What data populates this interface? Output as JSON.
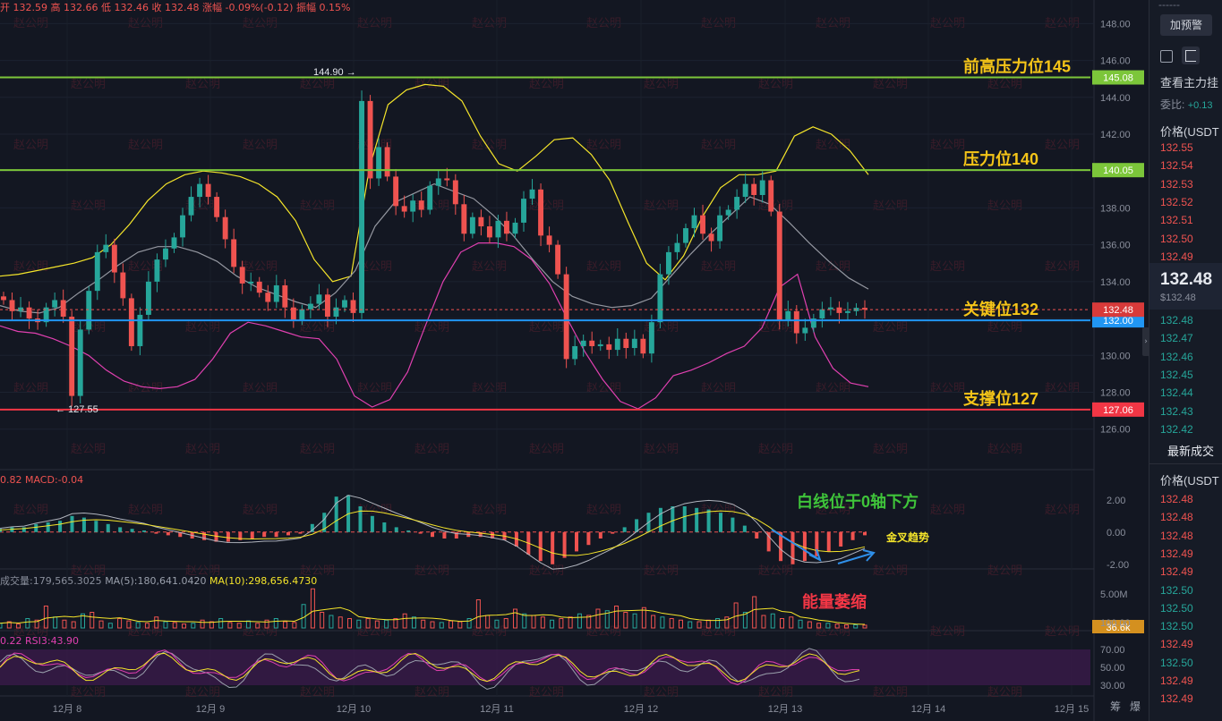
{
  "header": {
    "open": "开 132.59",
    "high": "高 132.66",
    "low": "低 132.46",
    "close": "收 132.48",
    "change": "涨幅 -0.09%(-0.12)",
    "amplitude": "振幅 0.15%"
  },
  "watermark": "赵公明",
  "colors": {
    "up": "#26a69a",
    "down": "#ef5350",
    "green_line": "#7cc63a",
    "red_line": "#f23645",
    "blue_line": "#2196f3",
    "label_text": "#f5c518",
    "boll_upper": "#f5e52a",
    "boll_lower": "#e040b0",
    "boll_mid": "#9598a1"
  },
  "chart_data": [
    {
      "type": "candlestick",
      "title": "",
      "ylim": [
        125.5,
        148.6
      ],
      "yticks": [
        "148.00",
        "146.00",
        "144.00",
        "142.00",
        "140.00",
        "138.00",
        "136.00",
        "134.00",
        "132.00",
        "130.00",
        "128.00",
        "126.00"
      ],
      "xticks": [
        "12月 8",
        "12月 9",
        "12月 10",
        "12月 11",
        "12月 12",
        "12月 13",
        "12月 14",
        "12月 15"
      ],
      "price_series": [
        133.0,
        132.4,
        132.6,
        132.0,
        131.8,
        132.6,
        133.0,
        132.1,
        127.8,
        131.4,
        133.5,
        135.6,
        136.0,
        134.5,
        133.1,
        130.5,
        132.2,
        134.0,
        135.2,
        135.8,
        136.4,
        137.6,
        138.6,
        139.3,
        138.6,
        137.5,
        136.3,
        134.8,
        133.9,
        134.0,
        133.4,
        132.9,
        133.8,
        132.6,
        131.9,
        132.5,
        132.8,
        133.3,
        132.1,
        132.6,
        133.0,
        132.3,
        143.8,
        139.6,
        141.3,
        139.7,
        138.1,
        137.8,
        138.4,
        137.9,
        139.2,
        139.6,
        139.5,
        138.2,
        136.6,
        137.5,
        137.0,
        136.4,
        137.3,
        136.6,
        137.2,
        138.5,
        139.0,
        136.5,
        136.0,
        134.4,
        129.8,
        130.5,
        130.8,
        130.5,
        130.6,
        130.3,
        130.9,
        130.4,
        130.9,
        130.1,
        131.8,
        134.4,
        135.6,
        136.1,
        136.9,
        137.6,
        136.6,
        136.2,
        137.6,
        137.9,
        138.6,
        139.3,
        138.7,
        139.5,
        137.8,
        131.9,
        132.4,
        131.2,
        131.5,
        132.0,
        132.5,
        132.6,
        132.3,
        132.4,
        132.58,
        132.48
      ],
      "boll_upper": [
        134.3,
        134.4,
        134.6,
        134.8,
        135.0,
        135.3,
        136.0,
        137.1,
        138.4,
        139.3,
        139.8,
        140.0,
        139.9,
        139.7,
        139.3,
        138.6,
        137.3,
        135.2,
        134.0,
        134.3,
        140.2,
        143.6,
        144.4,
        144.7,
        144.6,
        143.8,
        141.9,
        140.4,
        140.0,
        140.8,
        141.7,
        141.8,
        140.9,
        139.5,
        137.2,
        135.0,
        134.1,
        135.4,
        137.5,
        139.1,
        139.8,
        139.8,
        140.0,
        141.9,
        142.4,
        142.0,
        141.1,
        139.8
      ],
      "boll_lower": [
        131.6,
        131.3,
        131.2,
        130.9,
        130.5,
        130.0,
        129.2,
        128.6,
        128.3,
        128.2,
        128.3,
        128.7,
        129.8,
        131.2,
        131.8,
        131.6,
        131.3,
        131.0,
        130.9,
        129.8,
        127.8,
        127.2,
        127.6,
        129.1,
        131.6,
        134.0,
        135.6,
        136.1,
        136.1,
        135.9,
        135.2,
        133.9,
        132.0,
        130.2,
        128.7,
        127.5,
        127.1,
        127.7,
        128.9,
        129.2,
        129.6,
        130.1,
        130.5,
        131.5,
        133.7,
        134.4,
        131.0,
        129.3,
        128.5,
        128.3
      ],
      "boll_mid_sample": [
        132.7,
        132.4,
        132.3,
        132.6,
        133.4,
        134.1,
        134.9,
        135.6,
        135.9,
        135.9,
        135.6,
        135.1,
        134.3,
        133.7,
        133.3,
        132.9,
        132.6,
        133.4,
        134.6,
        137.0,
        138.3,
        138.8,
        139.3,
        138.9,
        138.5,
        137.6,
        136.5,
        135.2,
        134.0,
        133.2,
        132.8,
        132.6,
        132.7,
        133.1,
        134.3,
        135.5,
        136.6,
        137.6,
        138.6,
        138.2,
        137.2,
        136.1,
        135.1,
        134.2,
        133.6
      ],
      "levels": [
        {
          "price": 145.08,
          "label": "前高压力位145",
          "tag": "145.08",
          "color": "#7cc63a"
        },
        {
          "price": 140.05,
          "label": "压力位140",
          "tag": "140.05",
          "color": "#7cc63a"
        },
        {
          "price": 131.9,
          "label": "关键位132",
          "tag": "132.00",
          "color": "#2196f3"
        },
        {
          "price": 127.06,
          "label": "支撑位127",
          "tag": "127.06",
          "color": "#f23645"
        }
      ],
      "last_price": "132.48",
      "high_marker": "144.90 →",
      "low_marker": "← 127.55"
    },
    {
      "type": "bar",
      "title": "",
      "legend": "0.82  MACD:-0.04",
      "ylim": [
        -2.4,
        2.6
      ],
      "yticks": [
        "2.00",
        "0.00",
        "-2.00"
      ],
      "histogram": [
        0.2,
        0.3,
        0.3,
        0.5,
        0.6,
        0.7,
        1.0,
        0.9,
        0.7,
        0.5,
        0.3,
        0.2,
        0.1,
        -0.1,
        -0.2,
        -0.3,
        -0.4,
        -0.5,
        -0.6,
        -0.6,
        -0.5,
        -0.4,
        -0.3,
        -0.3,
        -0.2,
        -0.1,
        0.5,
        1.2,
        2.2,
        2.3,
        1.6,
        1.0,
        0.6,
        0.3,
        0.1,
        -0.1,
        -0.3,
        -0.4,
        -0.4,
        -0.3,
        -0.3,
        -0.4,
        -0.5,
        -0.9,
        -1.4,
        -1.8,
        -2.0,
        -1.6,
        -1.2,
        -0.8,
        -0.4,
        -0.1,
        0.3,
        0.8,
        1.2,
        1.5,
        1.6,
        1.6,
        1.5,
        1.4,
        1.2,
        0.9,
        0.4,
        -0.4,
        -1.2,
        -1.8,
        -2.0,
        -1.8,
        -1.5,
        -1.2,
        -0.9,
        -0.5,
        -0.2
      ],
      "annotation_1": "白线位于0轴下方",
      "annotation_2": "金叉趋势"
    },
    {
      "type": "bar",
      "title": "",
      "legend_1": "成交量:179,565.3025",
      "legend_2": "MA(5):180,641.0420",
      "legend_3": "MA(10):298,656.4730",
      "yticks": [
        "5.00M"
      ],
      "last_tag": "36.6k",
      "volumes_k": [
        300,
        400,
        250,
        600,
        500,
        1400,
        700,
        500,
        400,
        900,
        1000,
        450,
        300,
        600,
        450,
        350,
        300,
        700,
        400,
        350,
        250,
        300,
        500,
        400,
        600,
        350,
        300,
        450,
        300,
        500,
        600,
        400,
        350,
        1500,
        2500,
        1000,
        800,
        700,
        600,
        500,
        600,
        450,
        500,
        600,
        900,
        700,
        500,
        400,
        350,
        450,
        400,
        600,
        1800,
        800,
        500,
        600,
        1200,
        900,
        800,
        700,
        500,
        600,
        700,
        900,
        800,
        1200,
        1100,
        1400,
        1000,
        900,
        1300,
        800,
        700,
        600,
        500,
        400,
        400,
        500,
        600,
        700,
        1600,
        1000,
        2000,
        800,
        900,
        600,
        700,
        500,
        400,
        300,
        300,
        250,
        200,
        200,
        180
      ],
      "annotation": "能量萎缩"
    },
    {
      "type": "line",
      "title": "",
      "legend": "0.22  RSI3:43.90",
      "yticks": [
        "100.00",
        "70.00",
        "50.00",
        "30.00"
      ],
      "ylim": [
        0,
        100
      ]
    }
  ],
  "side_panel": {
    "dash": "------",
    "alert_button": "加预警",
    "main_label": "查看主力挂",
    "ratio_label": "委比:",
    "ratio_value": "+0.13",
    "price_header": "价格(USDT",
    "asks": [
      "132.55",
      "132.54",
      "132.53",
      "132.52",
      "132.51",
      "132.50",
      "132.49"
    ],
    "last_price": "132.48",
    "last_price_sub": "$132.48",
    "bids": [
      "132.48",
      "132.47",
      "132.46",
      "132.45",
      "132.44",
      "132.43",
      "132.42"
    ],
    "trades_title": "最新成交",
    "trades_header": "价格(USDT",
    "trades": [
      {
        "p": "132.48",
        "c": "#ef5350"
      },
      {
        "p": "132.48",
        "c": "#ef5350"
      },
      {
        "p": "132.48",
        "c": "#ef5350"
      },
      {
        "p": "132.49",
        "c": "#ef5350"
      },
      {
        "p": "132.49",
        "c": "#ef5350"
      },
      {
        "p": "132.50",
        "c": "#26a69a"
      },
      {
        "p": "132.50",
        "c": "#26a69a"
      },
      {
        "p": "132.50",
        "c": "#26a69a"
      },
      {
        "p": "132.49",
        "c": "#ef5350"
      },
      {
        "p": "132.50",
        "c": "#26a69a"
      },
      {
        "p": "132.49",
        "c": "#ef5350"
      },
      {
        "p": "132.49",
        "c": "#ef5350"
      }
    ]
  },
  "bottom_right": [
    "筹",
    "爆"
  ]
}
